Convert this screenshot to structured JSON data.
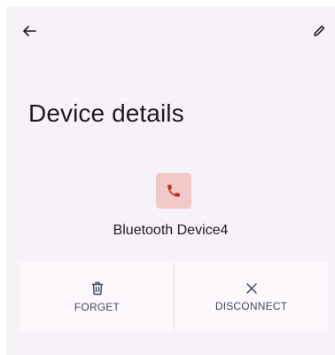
{
  "header": {
    "back_icon": "arrow-back-icon",
    "edit_icon": "pencil-icon"
  },
  "page": {
    "title": "Device details"
  },
  "device": {
    "icon": "phone-icon",
    "icon_bg_color": "#f2c9c9",
    "icon_color": "#c62828",
    "name": "Bluetooth Device4"
  },
  "actions": {
    "forget": {
      "label": "FORGET",
      "icon": "trash-icon"
    },
    "disconnect": {
      "label": "DISCONNECT",
      "icon": "close-icon"
    }
  },
  "colors": {
    "background": "#f7f2f7",
    "action_label": "#3f4a63"
  }
}
